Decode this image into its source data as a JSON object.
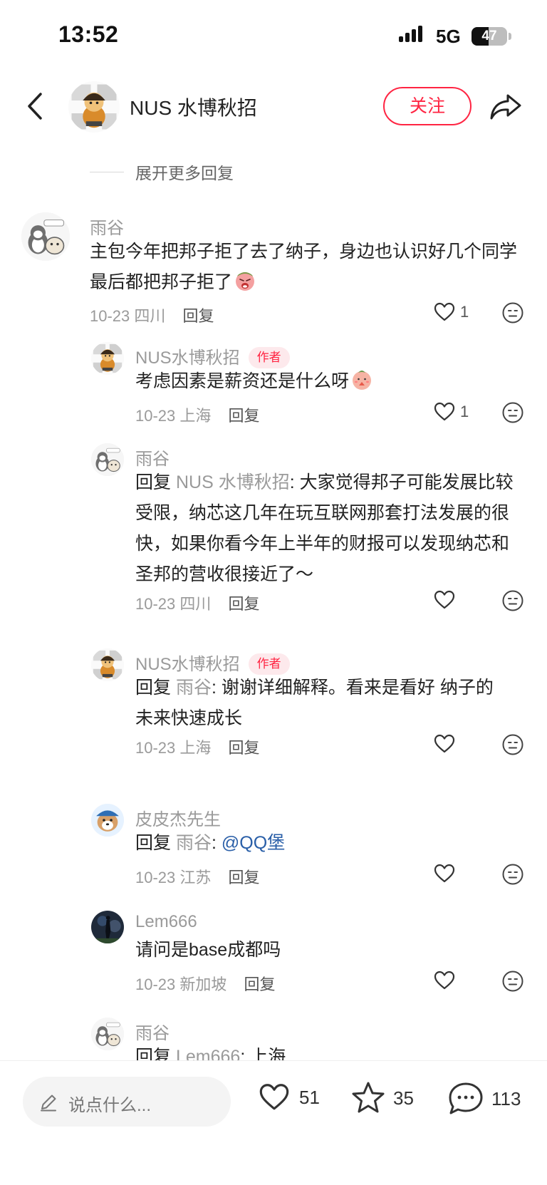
{
  "status_bar": {
    "time": "13:52",
    "network": "5G",
    "battery": "47",
    "battery_level": 0.47
  },
  "header": {
    "name": "NUS 水博秋招",
    "follow_label": "关注"
  },
  "expand_more": "展开更多回复",
  "comments": [
    {
      "name": "雨谷",
      "text": "主包今年把邦子拒了去了纳子，身边也认识好几个同学最后都把邦子拒了",
      "date": "10-23",
      "location": "四川",
      "reply_label": "回复",
      "likes": "1"
    },
    {
      "name": "NUS水博秋招",
      "badge": "作者",
      "text": "考虑因素是薪资还是什么呀",
      "date": "10-23",
      "location": "上海",
      "reply_label": "回复",
      "likes": "1"
    },
    {
      "name": "雨谷",
      "reply_word": "回复",
      "reply_target": "NUS 水博秋招",
      "text": ": 大家觉得邦子可能发展比较受限，纳芯这几年在玩互联网那套打法发展的很快，如果你看今年上半年的财报可以发现纳芯和圣邦的营收很接近了～",
      "date": "10-23",
      "location": "四川",
      "reply_label": "回复"
    },
    {
      "name": "NUS水博秋招",
      "badge": "作者",
      "reply_word": "回复",
      "reply_target": "雨谷",
      "text": ": 谢谢详细解释。看来是看好 纳子的未来快速成长",
      "date": "10-23",
      "location": "上海",
      "reply_label": "回复"
    },
    {
      "name": "皮皮杰先生",
      "reply_word": "回复",
      "reply_target": "雨谷",
      "text": ": ",
      "mention": "@QQ堡",
      "date": "10-23",
      "location": "江苏",
      "reply_label": "回复"
    },
    {
      "name": "Lem666",
      "text": "请问是base成都吗",
      "date": "10-23",
      "location": "新加坡",
      "reply_label": "回复"
    },
    {
      "name": "雨谷",
      "reply_word": "回复",
      "reply_target": "Lem666",
      "text": ": 上海"
    }
  ],
  "bottom_bar": {
    "input_placeholder": "说点什么...",
    "likes": "51",
    "stars": "35",
    "comments": "113"
  },
  "icons": {
    "back": "back-chevron-icon",
    "share": "share-arrow-icon",
    "like": "heart-icon",
    "dislike": "neutral-face-icon",
    "star": "star-icon",
    "comment": "comment-bubble-icon",
    "pencil": "pencil-icon"
  },
  "colors": {
    "accent": "#ff2442",
    "mention": "#2a5fa8"
  }
}
